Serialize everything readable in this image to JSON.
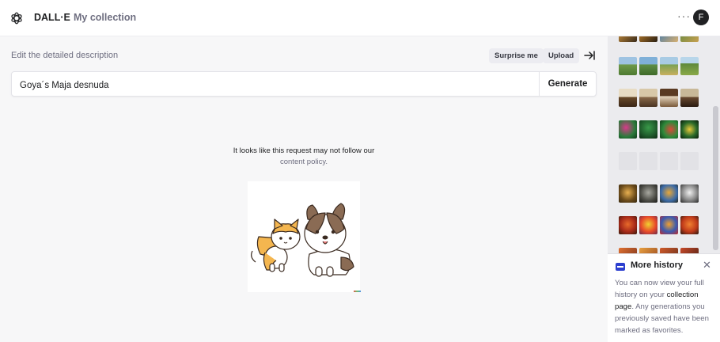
{
  "header": {
    "brand": "DALL·E",
    "nav_link": "My collection",
    "more": "···",
    "avatar_initial": "F"
  },
  "main": {
    "description_label": "Edit the detailed description",
    "surprise_label": "Surprise me",
    "upload_label": "Upload",
    "prompt_value": "Goya´s Maja desnuda",
    "generate_label": "Generate",
    "policy_message": "It looks like this request may not follow our",
    "policy_link": "content policy."
  },
  "sidebar": {
    "icon": "collapse-arrow-icon"
  },
  "toast": {
    "title": "More history",
    "body_1": "You can now view your full history on your ",
    "body_link": "collection page",
    "body_2": ". Any generations you previously saved have been marked as favorites.",
    "close": "✕"
  },
  "colors": {
    "accent": "#2c3fcf",
    "sidebar_bg": "#ebebee",
    "page_bg": "#f7f7f8"
  }
}
